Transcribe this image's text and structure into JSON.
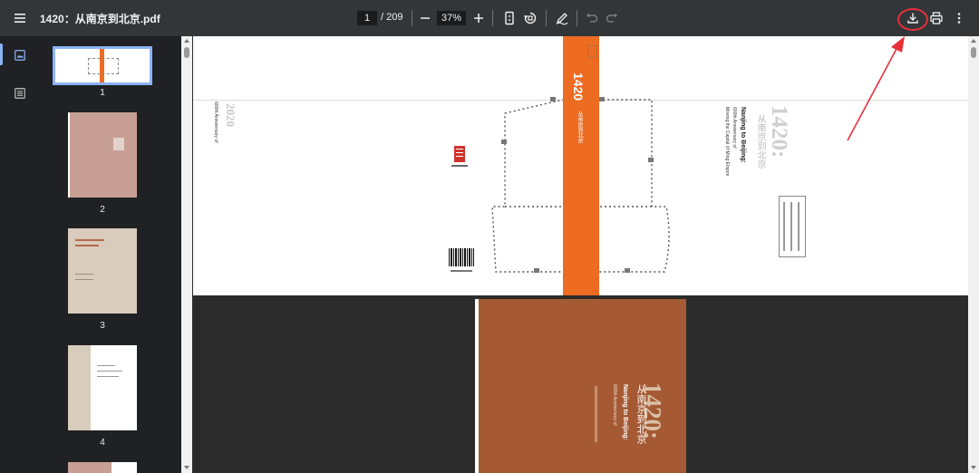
{
  "toolbar": {
    "title": "1420：从南京到北京.pdf",
    "current_page": "1",
    "total_pages": "/ 209",
    "zoom": "37%"
  },
  "sidebar": {
    "thumbnails": [
      {
        "label": "1"
      },
      {
        "label": "2"
      },
      {
        "label": "3"
      },
      {
        "label": "4"
      }
    ]
  },
  "cover": {
    "big_title": "1420:",
    "cn_title": "从南京到北京",
    "en_title": "Nanjing to Beijing:",
    "en_sub1": "600th Anniversary of",
    "en_sub2": "Moving the Capital of Ming Empire",
    "spine_num": "1420",
    "back_num": "2020",
    "spine_cn": "从南京到北京"
  },
  "colors": {
    "toolbar_bg": "#323639",
    "sidebar_bg": "#202124",
    "viewer_bg": "#2b2b2b",
    "spine_orange": "#ee6b22",
    "cover_brown": "#a55a33",
    "annotation_red": "#e8303a",
    "selection_blue": "#8ab4f8"
  }
}
